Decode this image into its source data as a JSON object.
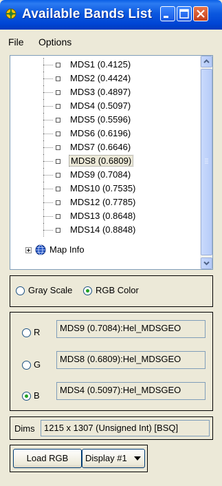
{
  "window": {
    "title": "Available Bands List"
  },
  "menu": {
    "file": "File",
    "options": "Options"
  },
  "bands": [
    "MDS1 (0.4125)",
    "MDS2 (0.4424)",
    "MDS3 (0.4897)",
    "MDS4 (0.5097)",
    "MDS5 (0.5596)",
    "MDS6 (0.6196)",
    "MDS7 (0.6646)",
    "MDS8 (0.6809)",
    "MDS9 (0.7084)",
    "MDS10 (0.7535)",
    "MDS12 (0.7785)",
    "MDS13 (0.8648)",
    "MDS14 (0.8848)"
  ],
  "selected_band": "MDS8 (0.6809)",
  "map_info": "Map Info",
  "mode": {
    "gray_label": "Gray Scale",
    "rgb_label": "RGB Color",
    "selected": "rgb"
  },
  "channels": {
    "r": {
      "label": "R",
      "value": "MDS9 (0.7084):Hel_MDSGEO"
    },
    "g": {
      "label": "G",
      "value": "MDS8 (0.6809):Hel_MDSGEO"
    },
    "b": {
      "label": "B",
      "value": "MDS4 (0.5097):Hel_MDSGEO",
      "selected": true
    }
  },
  "dims": {
    "label": "Dims",
    "value": "1215 x 1307 (Unsigned Int) [BSQ]"
  },
  "actions": {
    "load": "Load RGB",
    "display": "Display #1"
  },
  "colors": {
    "titlebar": "#0054e3",
    "radio_checked": "#21a121",
    "window_bg": "#ece9d8"
  }
}
